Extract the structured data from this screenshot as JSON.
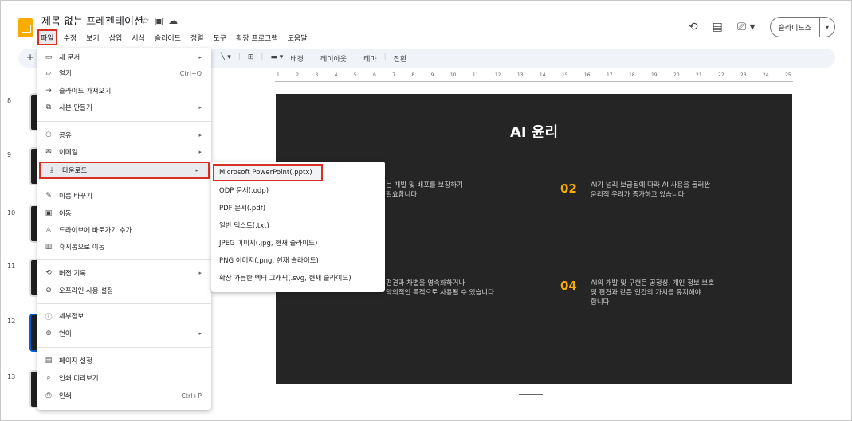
{
  "header": {
    "doc_title": "제목 없는 프레젠테이션",
    "title_icons": [
      "star-icon",
      "move-folder-icon",
      "cloud-status-icon"
    ],
    "menus": [
      "파일",
      "수정",
      "보기",
      "삽입",
      "서식",
      "슬라이드",
      "정렬",
      "도구",
      "확장 프로그램",
      "도움말"
    ],
    "slideshow_label": "슬라이드쇼",
    "right_icons": [
      "history-icon",
      "comments-icon",
      "meet-icon"
    ]
  },
  "toolbar": {
    "plus": "+",
    "items": [
      "배경",
      "레이아웃",
      "테마",
      "전환"
    ]
  },
  "filmstrip": {
    "numbers": [
      "8",
      "9",
      "10",
      "11",
      "12",
      "13"
    ]
  },
  "ruler": {
    "ticks": [
      "1",
      "2",
      "3",
      "4",
      "5",
      "6",
      "7",
      "8",
      "9",
      "10",
      "11",
      "12",
      "13",
      "14",
      "15",
      "16",
      "17",
      "18",
      "19",
      "20",
      "21",
      "22",
      "23",
      "24",
      "25"
    ]
  },
  "slide": {
    "title": "AI 윤리",
    "block1_text": "는 개발 및 배포를 보장하기\n필요합니다",
    "num2": "02",
    "block2_text": "AI가 널리 보급됨에 따라 AI 사용을 둘러싼\n윤리적 우려가 증가하고 있습니다",
    "block3_text": "편견과 차별을 영속화하거나\n악의적인 목적으로 사용될 수 있습니다",
    "num4": "04",
    "block4_text": "AI의 개발 및 구현은 공정성, 개인 정보 보호\n및 편견과 같은 인간의 가치를 유지해야\n합니다"
  },
  "file_menu": {
    "items": [
      {
        "label": "새 문서",
        "icon": "new-doc-icon",
        "arrow": true
      },
      {
        "label": "열기",
        "icon": "open-folder-icon",
        "shortcut": "Ctrl+O"
      },
      {
        "label": "슬라이드 가져오기",
        "icon": "import-icon"
      },
      {
        "label": "사본 만들기",
        "icon": "copy-icon",
        "arrow": true
      },
      {
        "label": "공유",
        "icon": "share-icon",
        "arrow": true
      },
      {
        "label": "이메일",
        "icon": "email-icon",
        "arrow": true
      },
      {
        "label": "다운로드",
        "icon": "download-icon",
        "arrow": true
      },
      {
        "label": "이름 바꾸기",
        "icon": "rename-icon"
      },
      {
        "label": "이동",
        "icon": "move-icon"
      },
      {
        "label": "드라이브에 바로가기 추가",
        "icon": "drive-shortcut-icon"
      },
      {
        "label": "휴지통으로 이동",
        "icon": "trash-icon"
      },
      {
        "label": "버전 기록",
        "icon": "history-icon",
        "arrow": true
      },
      {
        "label": "오프라인 사용 설정",
        "icon": "offline-icon"
      },
      {
        "label": "세부정보",
        "icon": "info-icon"
      },
      {
        "label": "언어",
        "icon": "globe-icon",
        "arrow": true
      },
      {
        "label": "페이지 설정",
        "icon": "page-setup-icon"
      },
      {
        "label": "인쇄 미리보기",
        "icon": "print-preview-icon"
      },
      {
        "label": "인쇄",
        "icon": "print-icon",
        "shortcut": "Ctrl+P"
      }
    ]
  },
  "download_menu": {
    "items": [
      "Microsoft PowerPoint(.pptx)",
      "ODP 문서(.odp)",
      "PDF 문서(.pdf)",
      "일반 텍스트(.txt)",
      "JPEG 이미지(.jpg, 현재 슬라이드)",
      "PNG 이미지(.png, 현재 슬라이드)",
      "확장 가능한 벡터 그래픽(.svg, 현재 슬라이드)"
    ]
  },
  "colors": {
    "highlight": "#d93025",
    "accent": "#f9ab00",
    "slide_bg": "#252525"
  }
}
